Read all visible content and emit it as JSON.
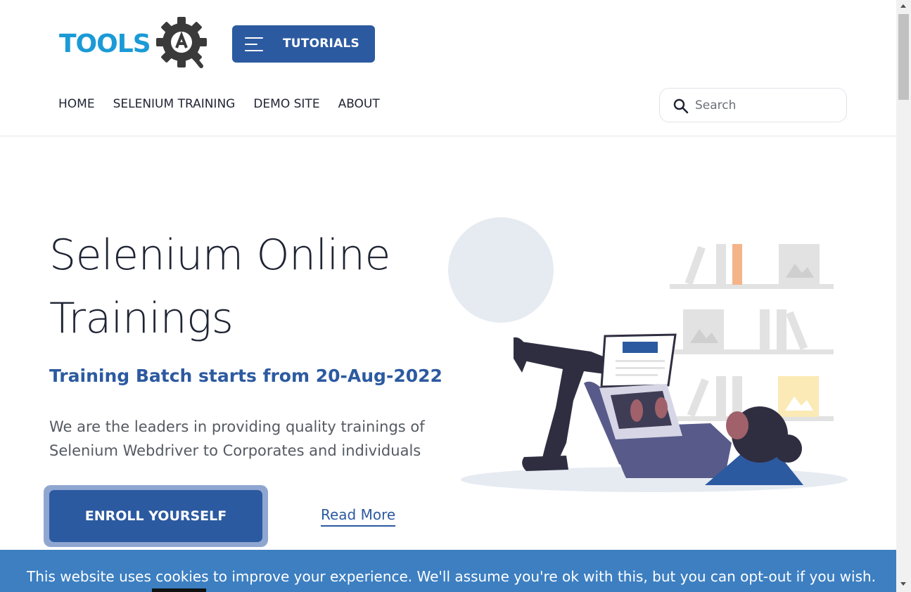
{
  "header": {
    "logo_text": "TOOLSQA",
    "tutorials_label": "TUTORIALS",
    "nav": [
      {
        "label": "HOME"
      },
      {
        "label": "SELENIUM TRAINING"
      },
      {
        "label": "DEMO SITE"
      },
      {
        "label": "ABOUT"
      }
    ],
    "search": {
      "placeholder": "Search",
      "value": ""
    }
  },
  "hero": {
    "title": "Selenium Online Trainings",
    "batch": "Training Batch starts from 20-Aug-2022",
    "description": "We are the leaders in providing quality trainings of Selenium Webdriver to Corporates and individuals",
    "enroll_label": "ENROLL YOURSELF",
    "read_more_label": "Read More"
  },
  "cookie_banner": {
    "text": "This website uses cookies to improve your experience. We'll assume you're ok with this, but you can opt-out if you wish."
  },
  "colors": {
    "brand_blue": "#2c5aa0",
    "logo_blue": "#1b9ad6",
    "cookie_bg": "#3d7fc1"
  },
  "icons": [
    "hamburger-icon",
    "search-icon",
    "gear-logo-icon"
  ]
}
